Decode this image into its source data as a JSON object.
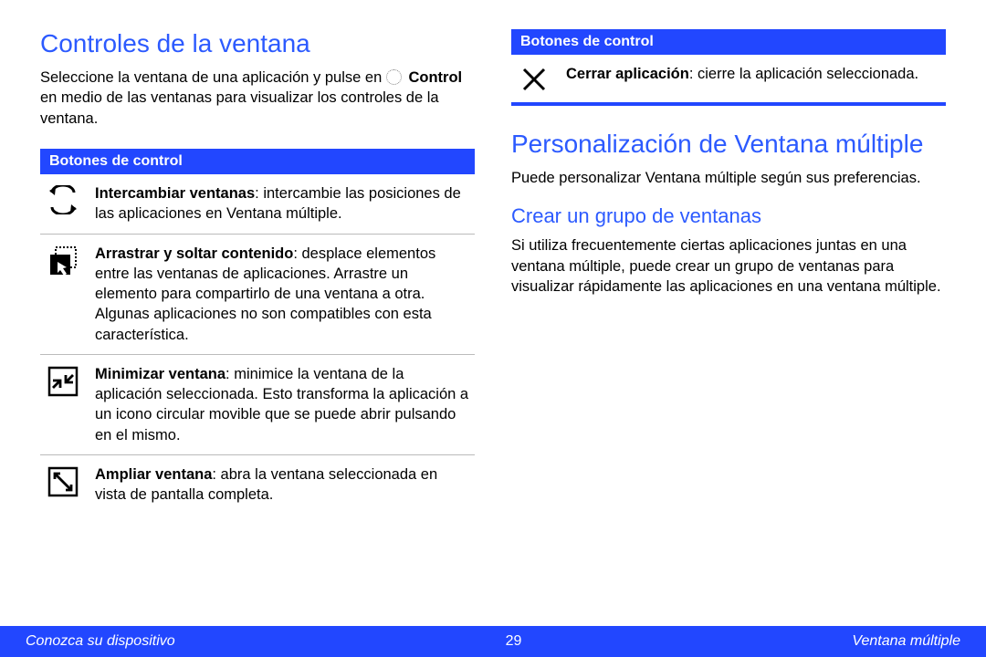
{
  "left": {
    "title": "Controles de la ventana",
    "intro_pre": "Seleccione la ventana de una aplicación y pulse en ",
    "intro_bold": "Control",
    "intro_post": " en medio de las ventanas para visualizar los controles de la ventana.",
    "table_header": "Botones de control",
    "rows": [
      {
        "icon": "swap-icon",
        "bold": "Intercambiar ventanas",
        "rest": ": intercambie las posiciones de las aplicaciones en Ventana múltiple."
      },
      {
        "icon": "drag-drop-icon",
        "bold": "Arrastrar y soltar contenido",
        "rest": ": desplace elementos entre las ventanas de aplicaciones. Arrastre un elemento para compartirlo de una ventana a otra. Algunas aplicaciones no son compatibles con esta característica."
      },
      {
        "icon": "minimize-icon",
        "bold": "Minimizar ventana",
        "rest": ": minimice la ventana de la aplicación seleccionada. Esto transforma la aplicación a un icono circular movible que se puede abrir pulsando en el mismo."
      },
      {
        "icon": "expand-icon",
        "bold": "Ampliar ventana",
        "rest": ": abra la ventana seleccionada en vista de pantalla completa."
      }
    ]
  },
  "right": {
    "table_header": "Botones de control",
    "close_row": {
      "icon": "close-icon",
      "bold": "Cerrar aplicación",
      "rest": ": cierre la aplicación seleccionada."
    },
    "title2": "Personalización de Ventana múltiple",
    "para2": "Puede personalizar Ventana múltiple según sus preferencias.",
    "subtitle": "Crear un grupo de ventanas",
    "para3": "Si utiliza frecuentemente ciertas aplicaciones juntas en una ventana múltiple, puede crear un grupo de ventanas para visualizar rápidamente las aplicaciones en una ventana múltiple."
  },
  "footer": {
    "left": "Conozca su dispositivo",
    "page": "29",
    "right": "Ventana múltiple"
  }
}
